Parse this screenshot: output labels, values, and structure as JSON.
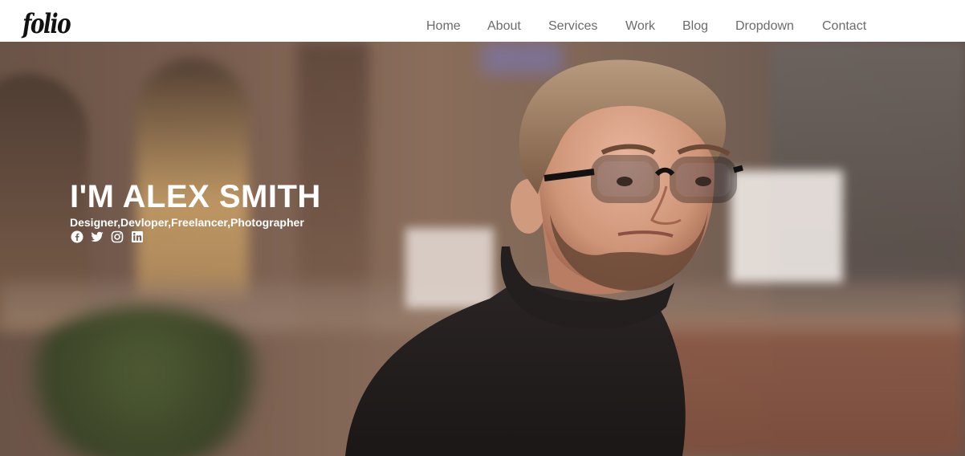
{
  "header": {
    "logo": "folio",
    "nav": [
      {
        "label": "Home"
      },
      {
        "label": "About"
      },
      {
        "label": "Services"
      },
      {
        "label": "Work"
      },
      {
        "label": "Blog"
      },
      {
        "label": "Dropdown"
      },
      {
        "label": "Contact"
      }
    ]
  },
  "hero": {
    "title": "I'M ALEX SMITH",
    "subtitle": "Designer,Devloper,Freelancer,Photographer",
    "socials": [
      {
        "icon": "facebook-icon"
      },
      {
        "icon": "twitter-icon"
      },
      {
        "icon": "instagram-icon"
      },
      {
        "icon": "linkedin-icon"
      }
    ]
  },
  "colors": {
    "header_bg": "#ffffff",
    "nav_text": "#6b6b6b",
    "hero_text": "#ffffff"
  }
}
